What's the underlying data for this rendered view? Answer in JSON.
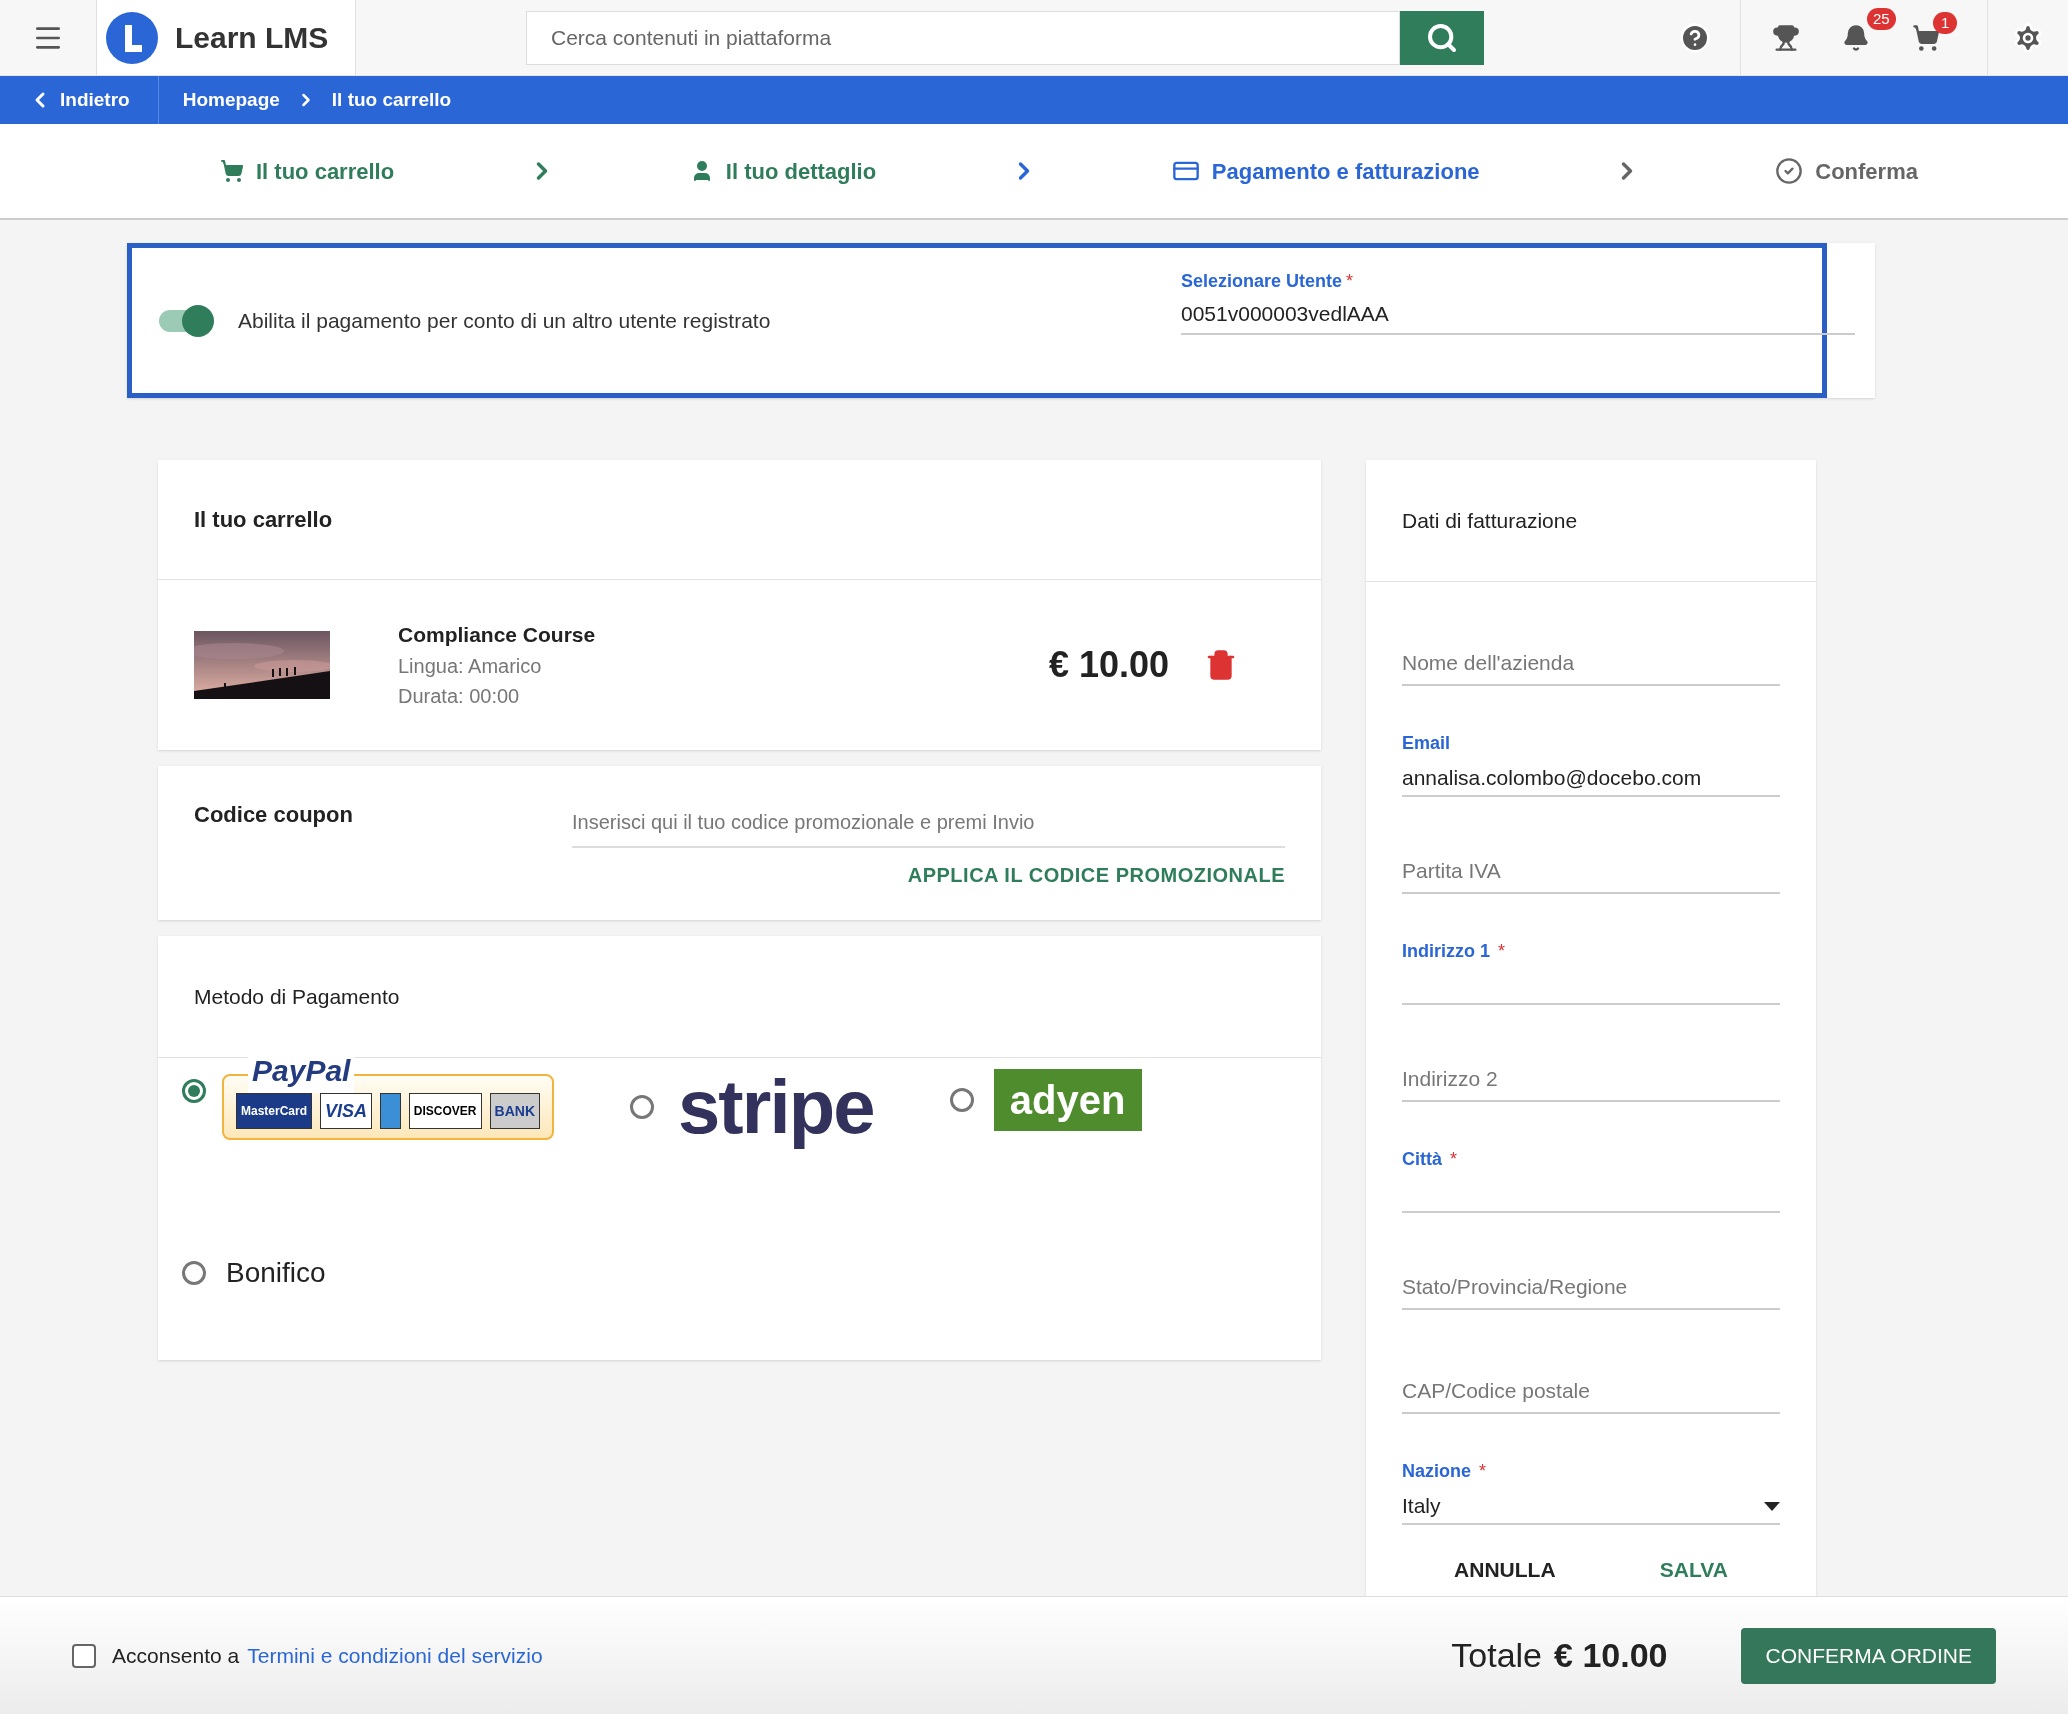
{
  "header": {
    "app_name": "Learn LMS",
    "search": {
      "placeholder": "Cerca contenuti in piattaforma"
    },
    "notifications_badge": "25",
    "cart_badge": "1"
  },
  "breadcrumb": {
    "back": "Indietro",
    "items": [
      "Homepage",
      "Il tuo carrello"
    ]
  },
  "steps": [
    {
      "label": "Il tuo carrello",
      "kind": "cart",
      "completed": true,
      "selected": false
    },
    {
      "label": "Il tuo dettaglio",
      "kind": "person",
      "completed": true,
      "selected": false
    },
    {
      "label": "Pagamento e fatturazione",
      "kind": "card",
      "completed": false,
      "selected": true
    },
    {
      "label": "Conferma",
      "kind": "check",
      "completed": false,
      "selected": false
    }
  ],
  "delegate": {
    "on": true,
    "label": "Abilita il pagamento per conto di un altro utente registrato",
    "user_field": {
      "label": "Selezionare Utente",
      "required_mark": "*",
      "value": "0051v000003vedlAAA"
    }
  },
  "cart": {
    "title": "Il tuo carrello",
    "items": [
      {
        "name": "Compliance Course",
        "language": "Lingua: Amarico",
        "duration": "Durata: 00:00",
        "price": "€ 10.00"
      }
    ]
  },
  "coupon": {
    "title": "Codice coupon",
    "placeholder": "Inserisci qui il tuo codice promozionale e premi Invio",
    "apply": "APPLICA IL CODICE PROMOZIONALE"
  },
  "payment": {
    "title": "Metodo di Pagamento",
    "methods": [
      {
        "kind": "paypal",
        "selected": true,
        "logo": "PayPal",
        "cards": [
          "MasterCard",
          "VISA",
          "DISCOVER",
          "BANK"
        ]
      },
      {
        "kind": "stripe",
        "selected": false,
        "logo": "stripe"
      },
      {
        "kind": "adyen",
        "selected": false,
        "logo": "adyen"
      },
      {
        "kind": "transfer",
        "selected": false,
        "label": "Bonifico"
      }
    ]
  },
  "billing": {
    "title": "Dati di fatturazione",
    "fields": [
      {
        "kind": "text",
        "placeholder": "Nome dell'azienda"
      },
      {
        "kind": "text",
        "label": "Email",
        "value": "annalisa.colombo@docebo.com"
      },
      {
        "kind": "text",
        "placeholder": "Partita IVA"
      },
      {
        "kind": "text",
        "label": "Indirizzo 1",
        "required_mark": "*"
      },
      {
        "kind": "text",
        "placeholder": "Indirizzo 2"
      },
      {
        "kind": "text",
        "label": "Città",
        "required_mark": "*"
      },
      {
        "kind": "text",
        "placeholder": "Stato/Provincia/Regione"
      },
      {
        "kind": "text",
        "placeholder": "CAP/Codice postale"
      },
      {
        "kind": "select",
        "label": "Nazione",
        "required_mark": "*",
        "value": "Italy"
      }
    ],
    "buttons": [
      {
        "label": "ANNULLA",
        "kind": "cancel"
      },
      {
        "label": "SALVA",
        "kind": "save"
      }
    ]
  },
  "footer": {
    "consent": {
      "checked": false,
      "prefix": "Acconsento a",
      "link": "Termini e condizioni del servizio"
    },
    "total_label": "Totale",
    "total": "€ 10.00",
    "confirm": "CONFERMA ORDINE"
  }
}
